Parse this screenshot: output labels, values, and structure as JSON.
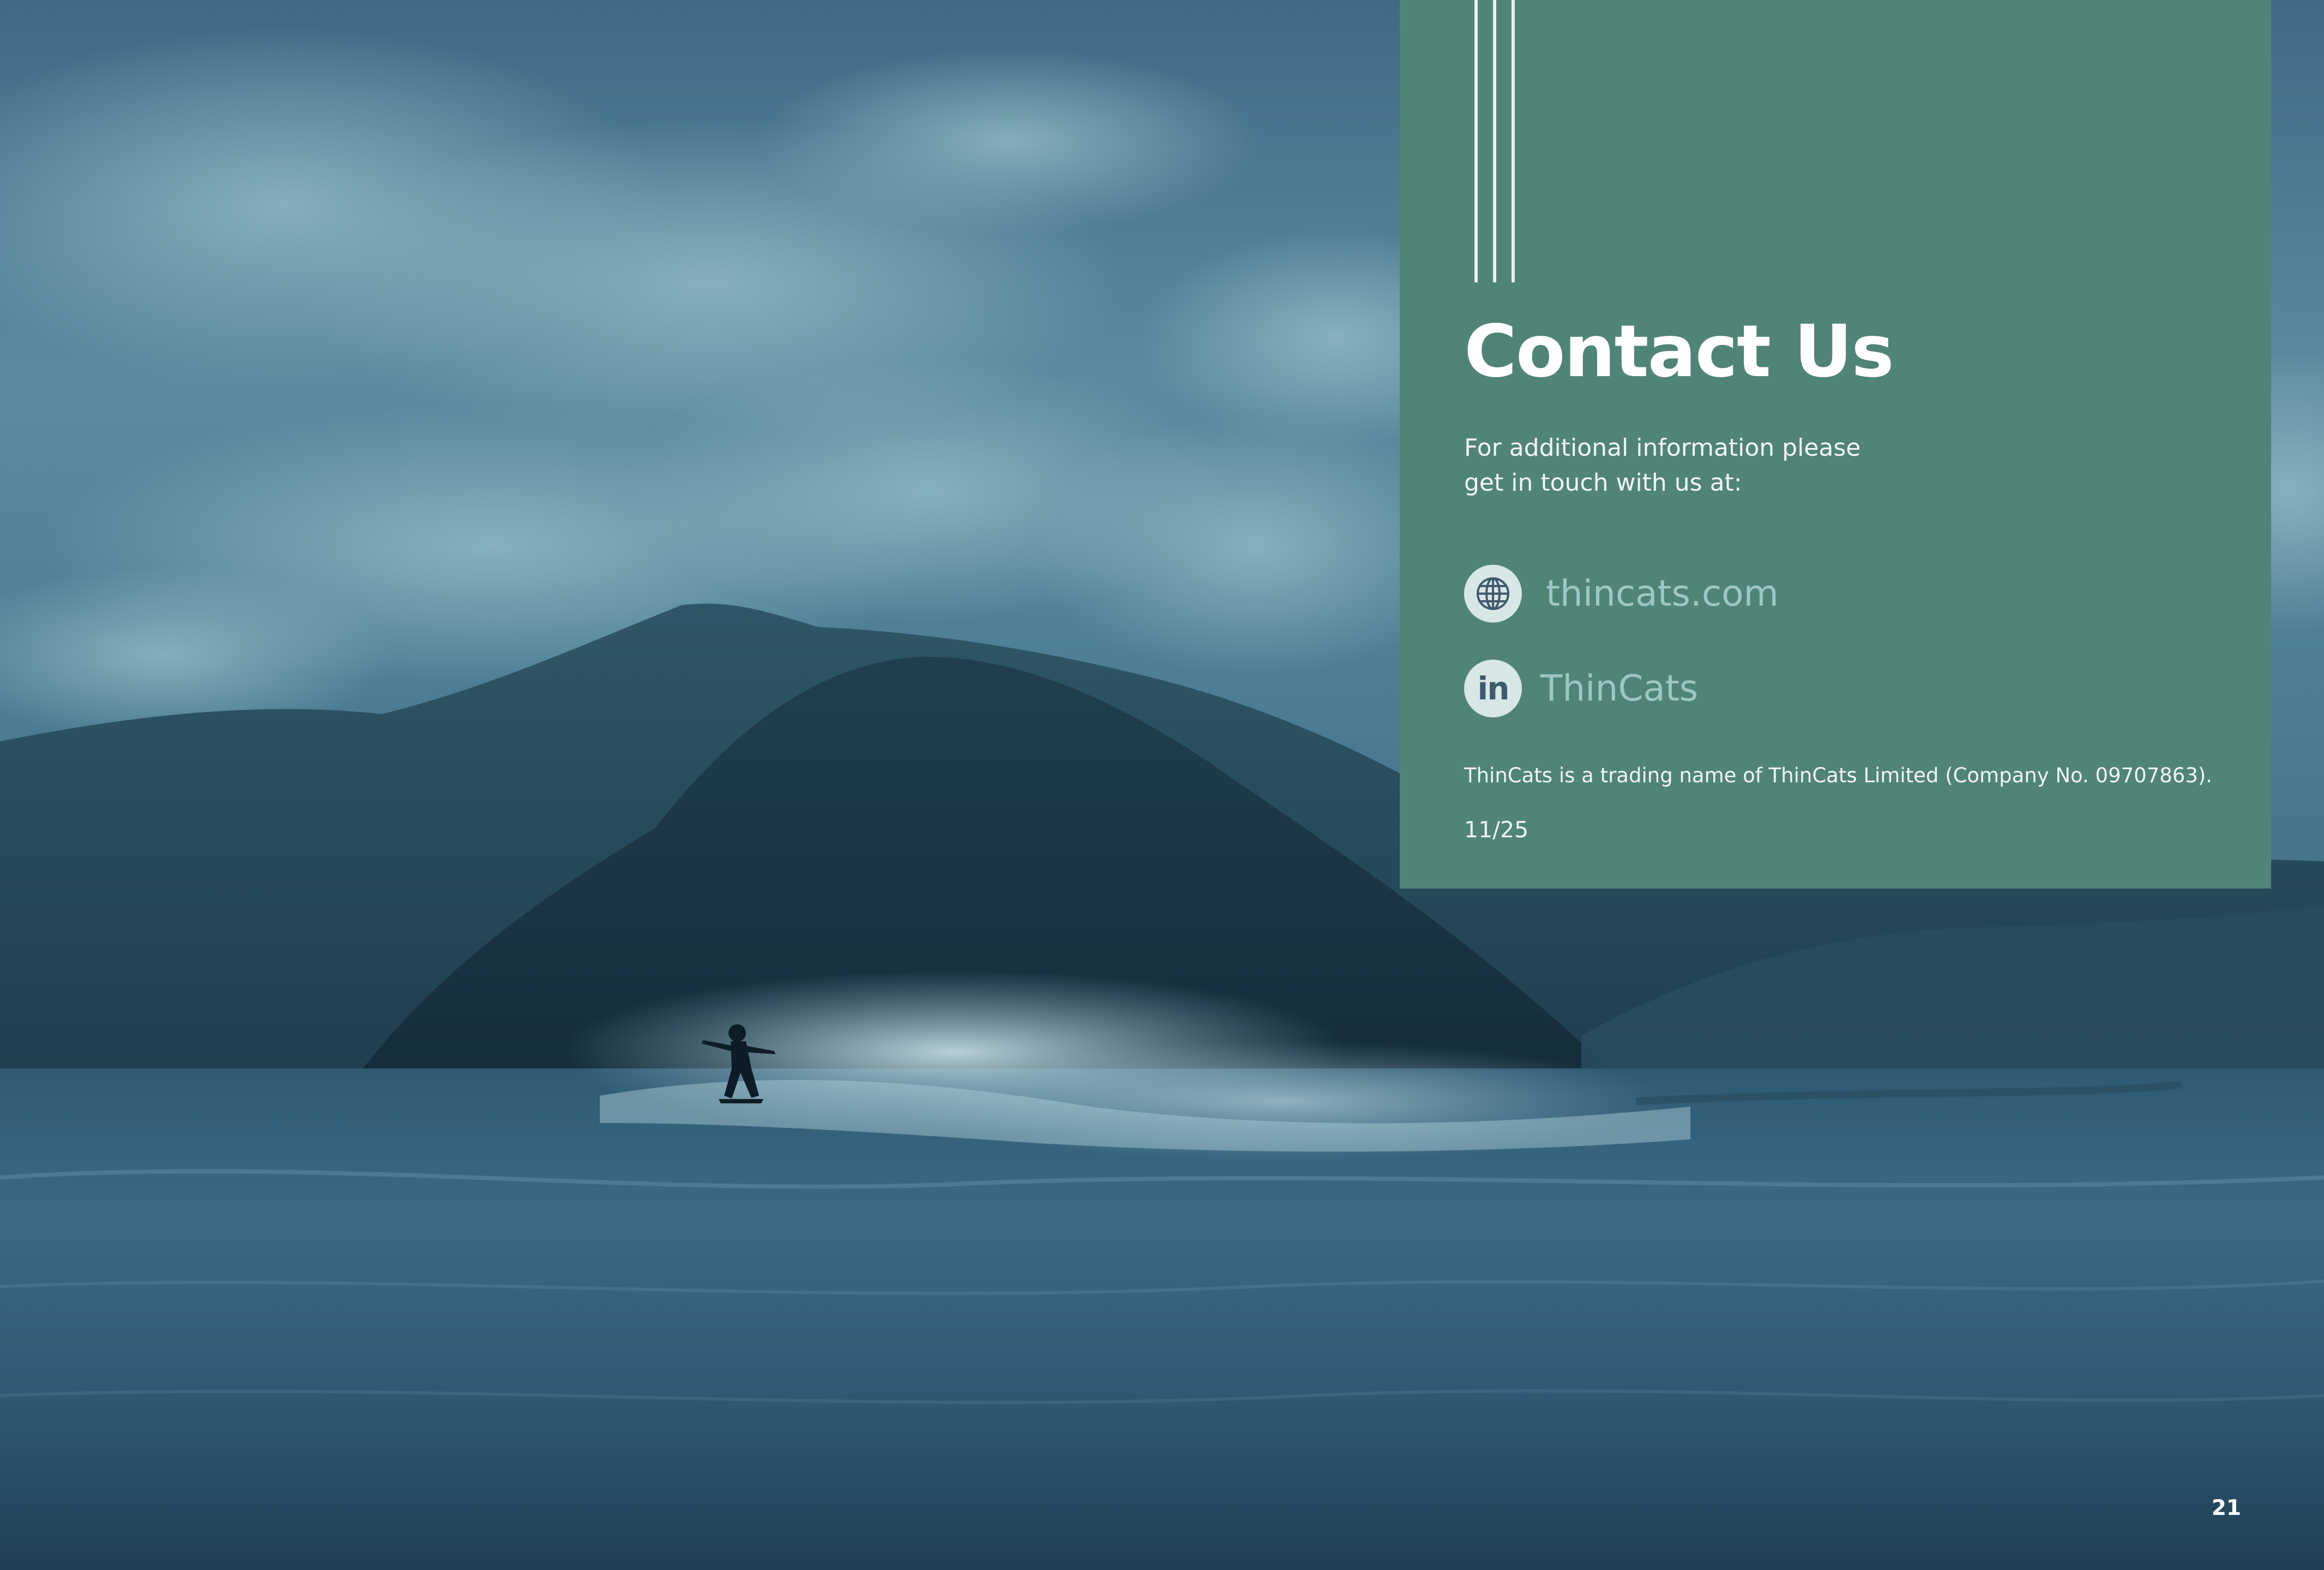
{
  "contact": {
    "title": "Contact Us",
    "intro_line1": "For additional information please",
    "intro_line2": "get in touch with us at:",
    "website": {
      "label": "thincats.com",
      "icon": "globe-icon"
    },
    "linkedin": {
      "label": "ThinCats",
      "icon": "linkedin-icon",
      "icon_text": "in"
    },
    "legal_note": "ThinCats is a trading name of ThinCats Limited (Company No. 09707863).",
    "reference": "11/25"
  },
  "page": {
    "number": "21"
  },
  "colors": {
    "panel": "#508477",
    "text": "#ffffff",
    "link": "#9ec7c3",
    "icon_bg": "#d7e7e6",
    "icon_fg": "#3f5a6d"
  }
}
